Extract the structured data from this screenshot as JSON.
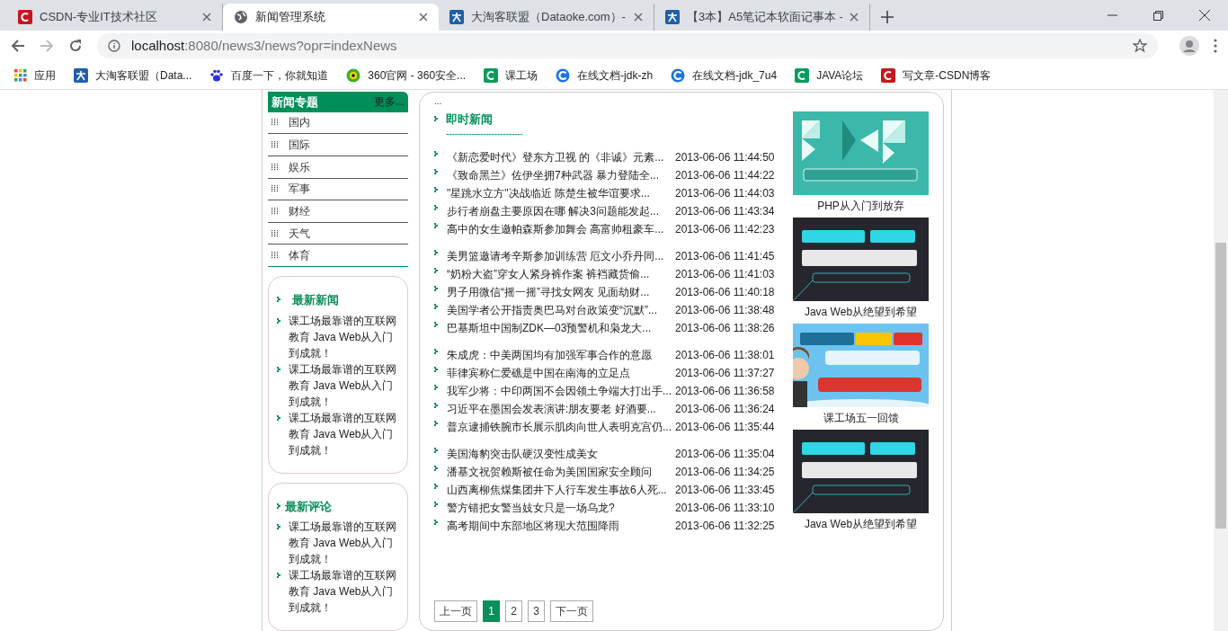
{
  "browser": {
    "tabs": [
      {
        "title": "CSDN-专业IT技术社区",
        "selected": false
      },
      {
        "title": "新闻管理系统",
        "selected": true
      },
      {
        "title": "大淘客联盟（Dataoke.com）-",
        "selected": false
      },
      {
        "title": "【3本】A5笔记本软面记事本 -",
        "selected": false
      }
    ],
    "address": {
      "host": "localhost",
      "rest": ":8080/news3/news?opr=indexNews"
    },
    "bookmarks": [
      "应用",
      "大淘客联盟（Data...",
      "百度一下，你就知道",
      "360官网 - 360安全...",
      "课工场",
      "在线文档-jdk-zh",
      "在线文档-jdk_7u4",
      "JAVA论坛",
      "写文章-CSDN博客"
    ]
  },
  "sidebar": {
    "title": "新闻专题",
    "more": "更多...",
    "topics": [
      "国内",
      "国际",
      "娱乐",
      "军事",
      "财经",
      "天气",
      "体育"
    ],
    "latest_news": {
      "title": "最新新闻",
      "items": [
        "课工场最靠谱的互联网教育 Java Web从入门到成就！",
        "课工场最靠谱的互联网教育 Java Web从入门到成就！",
        "课工场最靠谱的互联网教育 Java Web从入门到成就！"
      ]
    },
    "latest_comments": {
      "title": "最新评论",
      "items": [
        "课工场最靠谱的互联网教育 Java Web从入门到成就！",
        "课工场最靠谱的互联网教育 Java Web从入门到成就！"
      ]
    }
  },
  "main": {
    "ellipsis": "...",
    "title": "即时新闻",
    "dashes": "---------------------------",
    "groups": [
      [
        {
          "title": "《新恋爱时代》登东方卫视 的《非诚》元素...",
          "date": "2013-06-06 11:44:50"
        },
        {
          "title": "《致命黑兰》佐伊坐拥7种武器 暴力登陆全...",
          "date": "2013-06-06 11:44:22"
        },
        {
          "title": "\"星跳水立方\"决战临近 陈楚生被华谊要求...",
          "date": "2013-06-06 11:44:03"
        },
        {
          "title": "步行者崩盘主要原因在哪 解决3问题能发起...",
          "date": "2013-06-06 11:43:34"
        },
        {
          "title": "高中的女生邀帕森斯参加舞会 高富帅租豪车...",
          "date": "2013-06-06 11:42:23"
        }
      ],
      [
        {
          "title": "美男篮邀请考辛斯参加训练营 厄文小乔丹同...",
          "date": "2013-06-06 11:41:45"
        },
        {
          "title": "“奶粉大盗”穿女人紧身裤作案 裤裆藏货偷...",
          "date": "2013-06-06 11:41:03"
        },
        {
          "title": "男子用微信“摇一摇”寻找女网友 见面劫财...",
          "date": "2013-06-06 11:40:18"
        },
        {
          "title": "美国学者公开指责奥巴马对台政策变“沉默”...",
          "date": "2013-06-06 11:38:48"
        },
        {
          "title": "巴基斯坦中国制ZDK—03预警机和枭龙大...",
          "date": "2013-06-06 11:38:26"
        }
      ],
      [
        {
          "title": "朱成虎：中美两国均有加强军事合作的意愿",
          "date": "2013-06-06 11:38:01"
        },
        {
          "title": "菲律宾称仁爱礁是中国在南海的立足点",
          "date": "2013-06-06 11:37:27"
        },
        {
          "title": "我军少将：中印两国不会因领土争端大打出手...",
          "date": "2013-06-06 11:36:58"
        },
        {
          "title": "习近平在墨国会发表演讲:朋友要老 好酒要...",
          "date": "2013-06-06 11:36:24"
        },
        {
          "title": "普京逮捕铁腕市长展示肌肉向世人表明克宫仍...",
          "date": "2013-06-06 11:35:44"
        }
      ],
      [
        {
          "title": "美国海豹突击队硬汉变性成美女",
          "date": "2013-06-06 11:35:04"
        },
        {
          "title": "潘基文祝贺赖斯被任命为美国国家安全顾问",
          "date": "2013-06-06 11:34:25"
        },
        {
          "title": "山西离柳焦煤集团井下人行车发生事故6人死...",
          "date": "2013-06-06 11:33:45"
        },
        {
          "title": "警方错把女警当妓女只是一场乌龙?",
          "date": "2013-06-06 11:33:10"
        },
        {
          "title": "高考期间中东部地区将现大范围降雨",
          "date": "2013-06-06 11:32:25"
        }
      ]
    ],
    "pagination": {
      "prev": "上一页",
      "pages": [
        {
          "label": "1",
          "selected": true
        },
        {
          "label": "2",
          "selected": false
        },
        {
          "label": "3",
          "selected": false
        }
      ],
      "next": "下一页"
    },
    "ads": [
      {
        "caption": "PHP从入门到放弃"
      },
      {
        "caption": "Java Web从绝望到希望"
      },
      {
        "caption": "课工场五一回馈"
      },
      {
        "caption": "Java Web从绝望到希望"
      }
    ]
  }
}
